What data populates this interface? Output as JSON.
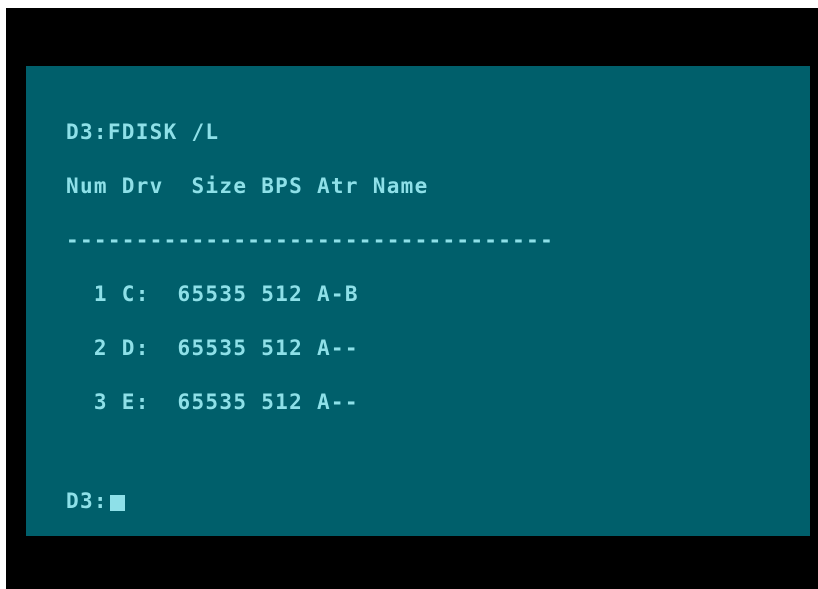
{
  "terminal": {
    "command": "D3:FDISK /L",
    "header": "Num Drv  Size BPS Atr Name",
    "separator": "-----------------------------------",
    "rows": [
      "  1 C:  65535 512 A-B",
      "  2 D:  65535 512 A--",
      "  3 E:  65535 512 A--"
    ],
    "prompt": "D3:"
  },
  "colors": {
    "screen_bg": "#005f6b",
    "text": "#8ee0e8",
    "border": "#000000"
  }
}
